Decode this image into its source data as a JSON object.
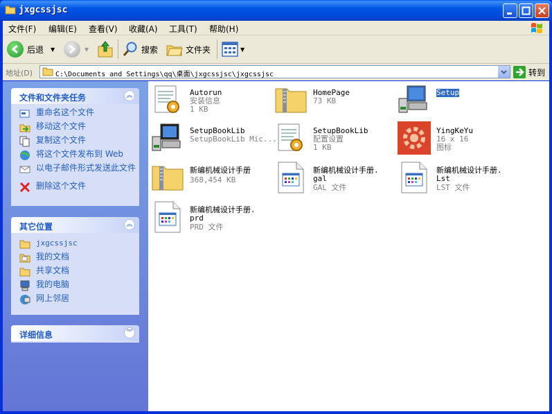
{
  "window": {
    "title": "jxgcssjsc"
  },
  "menu": [
    "文件(F)",
    "编辑(E)",
    "查看(V)",
    "收藏(A)",
    "工具(T)",
    "帮助(H)"
  ],
  "toolbar": {
    "back": "后退",
    "search": "搜索",
    "folders": "文件夹"
  },
  "address": {
    "label": "地址(D)",
    "path": "C:\\Documents and Settings\\qq\\桌面\\jxgcssjsc\\jxgcssjsc",
    "go": "转到"
  },
  "tasks_panel": {
    "title": "文件和文件夹任务",
    "items": [
      {
        "label": "重命名这个文件",
        "icon": "rename-icon"
      },
      {
        "label": "移动这个文件",
        "icon": "move-icon"
      },
      {
        "label": "复制这个文件",
        "icon": "copy-icon"
      },
      {
        "label": "将这个文件发布到 Web",
        "icon": "publish-web-icon"
      },
      {
        "label": "以电子邮件形式发送此文件",
        "icon": "email-icon"
      },
      {
        "label": "删除这个文件",
        "icon": "delete-icon"
      }
    ]
  },
  "places_panel": {
    "title": "其它位置",
    "items": [
      {
        "label": "jxgcssjsc",
        "icon": "folder-icon"
      },
      {
        "label": "我的文档",
        "icon": "my-documents-icon"
      },
      {
        "label": "共享文档",
        "icon": "shared-documents-icon"
      },
      {
        "label": "我的电脑",
        "icon": "my-computer-icon"
      },
      {
        "label": "网上邻居",
        "icon": "network-places-icon"
      }
    ]
  },
  "details_panel": {
    "title": "详细信息"
  },
  "files": [
    {
      "name": "Autorun",
      "line2": "安装信息",
      "line3": "1 KB",
      "icon": "inf-settings-icon"
    },
    {
      "name": "HomePage",
      "line2": "73 KB",
      "line3": "",
      "icon": "zip-folder-icon"
    },
    {
      "name": "Setup",
      "line2": "",
      "line3": "",
      "icon": "setup-computer-icon",
      "selected": true
    },
    {
      "name": "SetupBookLib",
      "line2": "SetupBookLib Mic...",
      "line3": "",
      "icon": "setup-computer-icon"
    },
    {
      "name": "SetupBookLib",
      "line2": "配置设置",
      "line3": "1 KB",
      "icon": "inf-settings-icon"
    },
    {
      "name": "YingKeYu",
      "line2": "16 x 16",
      "line3": "图标",
      "icon": "gear-image-icon"
    },
    {
      "name": "新编机械设计手册",
      "line2": "368,454 KB",
      "line3": "",
      "icon": "zip-folder-icon"
    },
    {
      "name": "新编机械设计手册.\ngal",
      "line2": "GAL 文件",
      "line3": "",
      "icon": "generic-file-icon"
    },
    {
      "name": "新编机械设计手册.\nLst",
      "line2": "LST 文件",
      "line3": "",
      "icon": "generic-file-icon"
    },
    {
      "name": "新编机械设计手册.\nprd",
      "line2": "PRD 文件",
      "line3": "",
      "icon": "generic-file-icon"
    }
  ]
}
